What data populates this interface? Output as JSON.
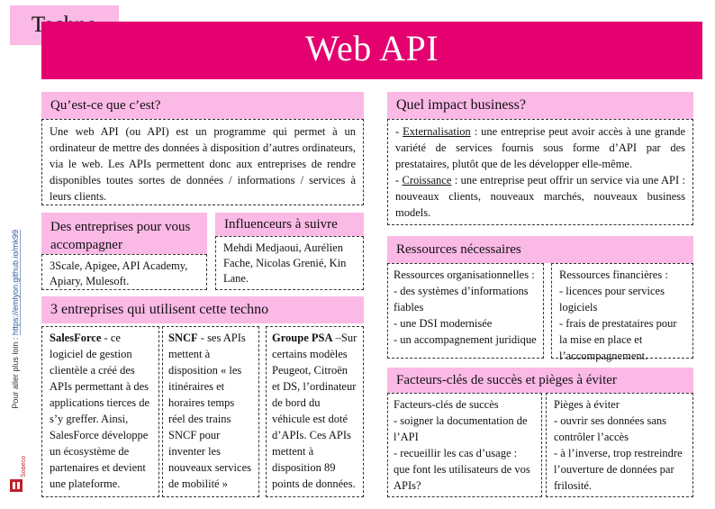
{
  "tag": "Techno",
  "title": "Web API",
  "side": {
    "prefix": "Pour aller plus loin : ",
    "link": "https://emlyon.github.io/mk99",
    "logo_text": "Sogeco"
  },
  "what": {
    "header": "Qu’est-ce que c’est?",
    "body": "Une web API (ou API) est un programme qui permet à un ordinateur de mettre des données à disposition d’autres ordinateurs, via le web. Les APIs permettent donc aux entreprises de rendre disponibles toutes sortes de données / informations / services à leurs clients."
  },
  "companies_help": {
    "header": "Des entreprises pour vous accompagner",
    "body": "3Scale, Apigee, API Academy, Apiary, Mulesoft."
  },
  "influencers": {
    "header": "Influenceurs à suivre",
    "body": "Mehdi Medjaoui, Aurélien Fache, Nicolas Grenié, Kin Lane."
  },
  "three_companies": {
    "header": "3 entreprises qui utilisent cette techno",
    "col1": {
      "name": "SalesForce",
      "text": " - ce logiciel de gestion clientèle a créé des APIs permettant à des applications tierces de s’y greffer. Ainsi, SalesForce développe un écosystème de partenaires et devient une plateforme."
    },
    "col2": {
      "name": "SNCF",
      "text": " - ses APIs mettent à disposition « les itinéraires et horaires temps réel des trains SNCF pour inventer les nouveaux services de mobilité »"
    },
    "col3": {
      "name": "Groupe PSA",
      "text": " –Sur certains modèles Peugeot, Citroën et DS, l’ordinateur de bord du véhicule est doté d’APIs. Ces APIs mettent à disposition 89 points de données."
    }
  },
  "impact": {
    "header": "Quel impact business?",
    "item1_dash": "- ",
    "item1_term": "Externalisation",
    "item1_text": " : une entreprise peut avoir accès à une grande variété de services fournis sous forme d’API par des prestataires, plutôt que de les développer elle-même.",
    "item2_dash": "- ",
    "item2_term": "Croissance",
    "item2_text": " : une entreprise peut offrir un service via une API : nouveaux clients, nouveaux marchés, nouveaux business models."
  },
  "resources": {
    "header": "Ressources nécessaires",
    "left": [
      "Ressources organisationnelles :",
      "- des systèmes d’informations fiables",
      "- une DSI modernisée",
      "- un accompagnement juridique"
    ],
    "right": [
      "Ressources financières :",
      "- licences pour services logiciels",
      "- frais de prestataires pour la mise en place et l’accompagnement."
    ]
  },
  "factors": {
    "header": "Facteurs-clés de succès et pièges à éviter",
    "left": [
      "Facteurs-clés de succès",
      "- soigner la documentation de l’API",
      "- recueillir les cas d’usage : que font les utilisateurs de vos APIs?"
    ],
    "right": [
      "Pièges à éviter",
      "- ouvrir ses données sans contrôler l’accès",
      "- à l’inverse, trop restreindre l’ouverture de données par frilosité."
    ]
  },
  "colors": {
    "magenta": "#e4006f",
    "pink": "#fbb9e6"
  }
}
